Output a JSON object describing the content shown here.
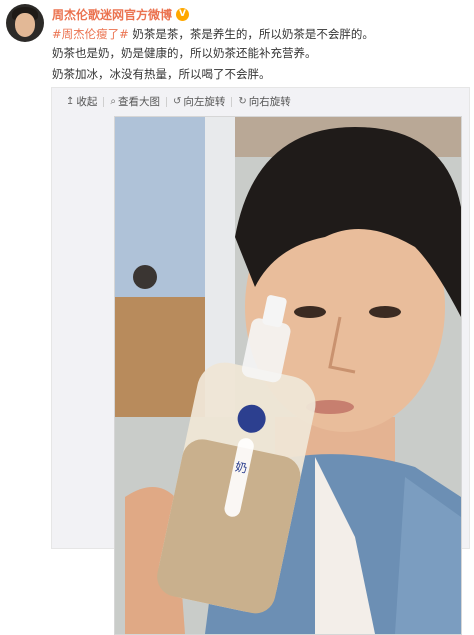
{
  "post": {
    "author": "周杰伦歌迷网官方微博",
    "verified_badge": "V",
    "hashtag": "#周杰伦瘦了#",
    "line1_rest": " 奶茶是茶，茶是养生的，所以奶茶是不会胖的。",
    "line2": "奶茶也是奶，奶是健康的，所以奶茶还能补充营养。",
    "line3": "奶茶加冰，冰没有热量，所以喝了不会胖。"
  },
  "toolbar": {
    "collapse": "收起",
    "view_large": "查看大图",
    "rotate_left": "向左旋转",
    "rotate_right": "向右旋转"
  },
  "photo": {
    "bottle_lid_text": "奶"
  },
  "icons": {
    "collapse": "collapse-up-icon",
    "view_large": "magnifier-icon",
    "rotate_left": "rotate-left-icon",
    "rotate_right": "rotate-right-icon"
  },
  "colors": {
    "link_orange": "#eb7350",
    "badge_gold": "#ffa800",
    "text": "#333333"
  }
}
